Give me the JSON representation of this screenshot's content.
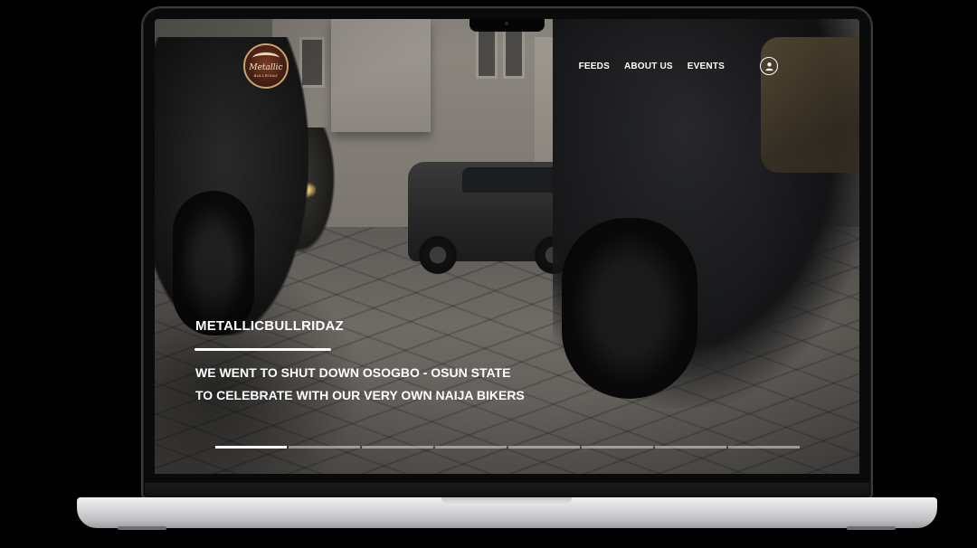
{
  "header": {
    "logo": {
      "name": "Metallic",
      "subtitle": "BULLRIDAZ"
    },
    "nav": [
      {
        "label": "FEEDS"
      },
      {
        "label": "ABOUT US"
      },
      {
        "label": "EVENTS"
      }
    ],
    "account_icon": "user-icon"
  },
  "hero": {
    "title": "METALLICBULLRIDAZ",
    "subtitle_line1": "WE WENT TO SHUT DOWN OSOGBO - OSUN STATE",
    "subtitle_line2": "TO CELEBRATE WITH OUR VERY OWN NAIJA BIKERS"
  },
  "slider": {
    "total_slides": 8,
    "active_index": 0
  },
  "colors": {
    "text": "#ffffff",
    "page_background": "#000000",
    "slider_inactive": "rgba(255,255,255,0.45)",
    "logo_ring": "#c9a46a",
    "logo_fill": "#4a2014"
  }
}
